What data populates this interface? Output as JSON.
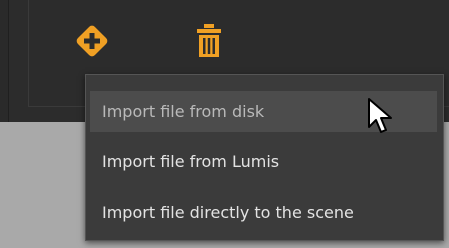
{
  "toolbar": {
    "add_icon": "plus-diamond-icon",
    "delete_icon": "trash-icon",
    "accent_color": "#f0a024"
  },
  "menu": {
    "items": [
      {
        "label": "Import file from disk",
        "state": "hovered"
      },
      {
        "label": "Import file from Lumis"
      },
      {
        "label": "Import file directly to the scene"
      }
    ]
  },
  "colors": {
    "panel_bg": "#2c2c2c",
    "menu_bg": "#3b3b3b",
    "menu_hover_bg": "#4c4c4c",
    "menu_text": "#e3e3e3",
    "page_bg": "#a9a9a9"
  }
}
